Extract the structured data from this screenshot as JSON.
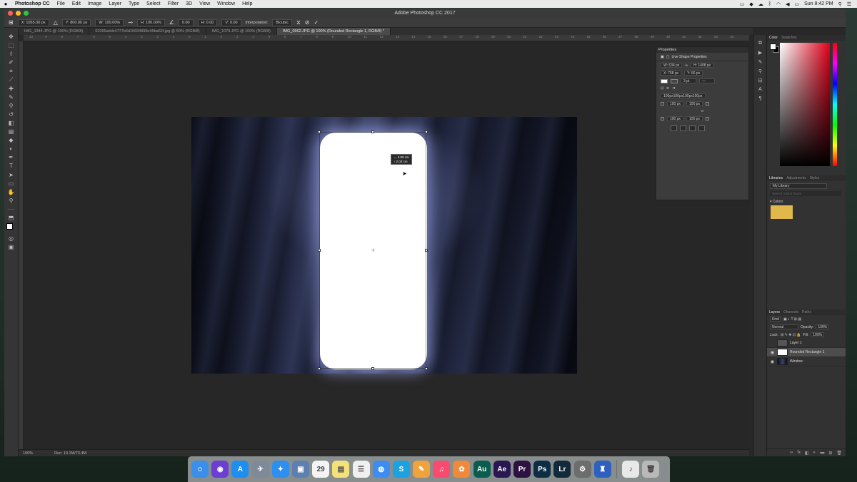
{
  "menubar": {
    "app_name": "Photoshop CC",
    "items": [
      "File",
      "Edit",
      "Image",
      "Layer",
      "Type",
      "Select",
      "Filter",
      "3D",
      "View",
      "Window",
      "Help"
    ],
    "clock": "Sun 8:42 PM"
  },
  "window": {
    "title": "Adobe Photoshop CC 2017"
  },
  "options": {
    "x": "X: 1055.00 px",
    "y": "Y: 800.00 px",
    "w": "W: 100.00%",
    "h": "H: 100.00%",
    "angle": "0.00",
    "hskew": "H: 0.00",
    "vskew": "V: 0.00",
    "interpolation_label": "Interpolation:",
    "interpolation_value": "Bicubic"
  },
  "tabs": [
    "IMG_1344.JPG @ 100% (RGB/8)",
    "02265addc4777b6d10694898e45ba62f.jpg @ 50% (RGB/8)",
    "IMG_1075.JPG @ 100% (RGB/8)",
    "IMG_0962.JPG @ 100% (Rounded Rectangle 1, RGB/8) *"
  ],
  "ruler_ticks": [
    "10",
    "9",
    "8",
    "7",
    "6",
    "5",
    "4",
    "3",
    "2",
    "1",
    "0",
    "1",
    "2",
    "3",
    "4",
    "5",
    "6",
    "7",
    "8",
    "9",
    "10",
    "11",
    "12",
    "13",
    "14",
    "15",
    "16",
    "17",
    "18",
    "19",
    "20",
    "21",
    "22",
    "23",
    "24",
    "25",
    "26",
    "27",
    "28",
    "29",
    "30",
    "31",
    "32",
    "33",
    "34"
  ],
  "canvas": {
    "tooltip_line1": "↔  3.00 cm",
    "tooltip_line2": "↕  2.03 cm"
  },
  "status": {
    "zoom": "100%",
    "doc": "Doc: 10.1M/73.4M"
  },
  "properties": {
    "title": "Properties",
    "section": "Live Shape Properties",
    "w": "W: 634 px",
    "h": "H: 1408 px",
    "x": "X: 758 px",
    "y": "Y: 66 px",
    "stroke_size": "3 pt",
    "radii_text": "100px100px100px100px",
    "r_tl": "100 px",
    "r_tr": "100 px",
    "r_bl": "100 px",
    "r_br": "100 px"
  },
  "color_panel": {
    "tabs": [
      "Color",
      "Swatches"
    ],
    "accent_red": "#e0001a"
  },
  "libraries": {
    "tabs": [
      "Libraries",
      "Adjustments",
      "Styles"
    ],
    "selected": "My Library",
    "search_placeholder": "Search Adobe Stock",
    "group": "Colors",
    "swatch_color": "#e0b94a"
  },
  "layers": {
    "tabs": [
      "Layers",
      "Channels",
      "Paths"
    ],
    "kind": "Kind",
    "blend": "Normal",
    "opacity_label": "Opacity:",
    "opacity": "100%",
    "lock_label": "Lock:",
    "fill_label": "Fill:",
    "fill": "100%",
    "items": [
      "Layer 1",
      "Rounded Rectangle 1",
      "Window"
    ]
  },
  "dock": {
    "apps": [
      {
        "label": "☺",
        "color": "#3c8fe8"
      },
      {
        "label": "◉",
        "color": "#6a3fd1"
      },
      {
        "label": "A",
        "color": "#1e8ef0"
      },
      {
        "label": "✈",
        "color": "#7f8a99"
      },
      {
        "label": "✦",
        "color": "#2d8ff0"
      },
      {
        "label": "▣",
        "color": "#5d80b0"
      },
      {
        "label": "29",
        "color": "#f4f4f4"
      },
      {
        "label": "▤",
        "color": "#f5e17a"
      },
      {
        "label": "☰",
        "color": "#f0f0f0"
      },
      {
        "label": "◍",
        "color": "#3d8cf0"
      },
      {
        "label": "S",
        "color": "#1ba2e0"
      },
      {
        "label": "✎",
        "color": "#f0a33a"
      },
      {
        "label": "♫",
        "color": "#fa4a70"
      },
      {
        "label": "✿",
        "color": "#f08a3a"
      },
      {
        "label": "Au",
        "color": "#0a5d4e"
      },
      {
        "label": "Ae",
        "color": "#2a1650"
      },
      {
        "label": "Pr",
        "color": "#2c1142"
      },
      {
        "label": "Ps",
        "color": "#0d2d45"
      },
      {
        "label": "Lr",
        "color": "#132a3a"
      },
      {
        "label": "⚙",
        "color": "#6d6d6d"
      },
      {
        "label": "♜",
        "color": "#2f60c0"
      }
    ],
    "trailing": [
      {
        "label": "♪",
        "color": "#e8e8e8"
      },
      {
        "label": "🗑",
        "color": "#b9b9b9"
      }
    ]
  }
}
